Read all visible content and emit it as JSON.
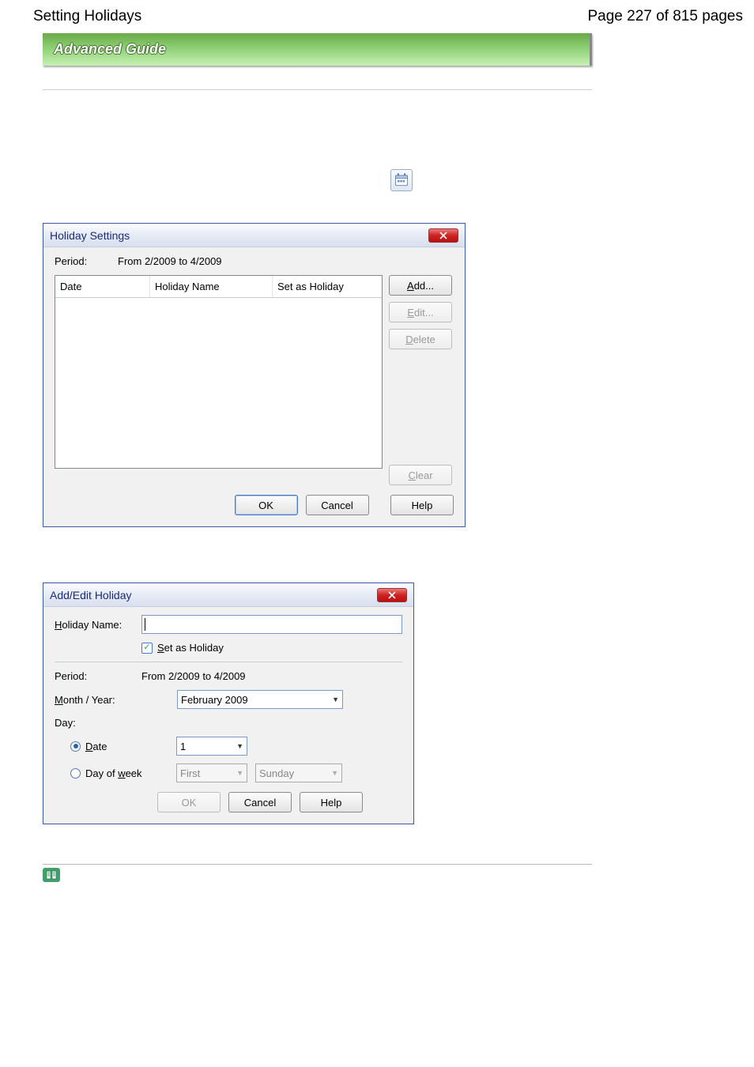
{
  "page": {
    "header_left": "Setting Holidays",
    "header_right": "Page 227 of 815 pages"
  },
  "banner": {
    "title": "Advanced Guide"
  },
  "holiday_dialog": {
    "title": "Holiday Settings",
    "period_label": "Period:",
    "period_value": "From 2/2009 to 4/2009",
    "columns": {
      "date": "Date",
      "name": "Holiday Name",
      "set": "Set as Holiday"
    },
    "buttons": {
      "add": "Add...",
      "edit": "Edit...",
      "delete": "Delete",
      "clear": "Clear",
      "ok": "OK",
      "cancel": "Cancel",
      "help": "Help"
    }
  },
  "addedit_dialog": {
    "title": "Add/Edit Holiday",
    "holiday_name_label": "Holiday Name:",
    "set_as_holiday_label": "Set as Holiday",
    "period_label": "Period:",
    "period_value": "From 2/2009 to 4/2009",
    "month_year_label": "Month / Year:",
    "month_year_value": "February 2009",
    "day_label": "Day:",
    "date_radio_label": "Date",
    "date_value": "1",
    "dow_radio_label": "Day of week",
    "dow_ordinal": "First",
    "dow_day": "Sunday",
    "buttons": {
      "ok": "OK",
      "cancel": "Cancel",
      "help": "Help"
    }
  }
}
